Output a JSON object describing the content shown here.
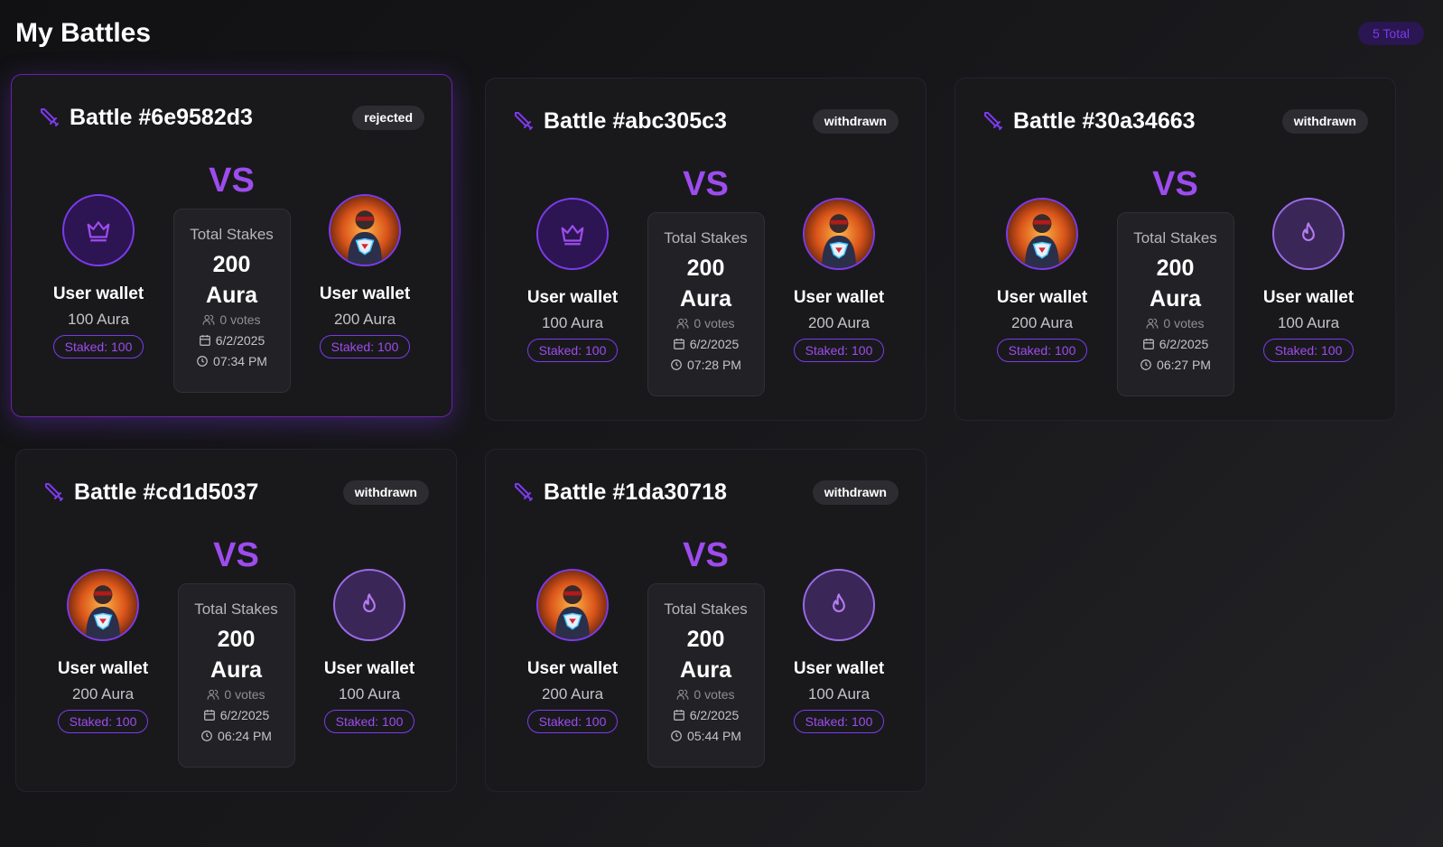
{
  "page": {
    "title": "My Battles",
    "total_badge": "5 Total"
  },
  "colors": {
    "accent": "#9d4ced",
    "card_bg": "#19191c",
    "badge_bg": "#2d2d31"
  },
  "battles": [
    {
      "title": "Battle #6e9582d3",
      "status": "rejected",
      "vs": "VS",
      "left": {
        "avatar": "crown-icon",
        "name": "User wallet",
        "aura": "100 Aura",
        "staked": "Staked: 100"
      },
      "right": {
        "avatar": "hero-avatar",
        "name": "User wallet",
        "aura": "200 Aura",
        "staked": "Staked: 100"
      },
      "stakes_label": "Total Stakes",
      "stakes_amount": "200 Aura",
      "votes": "0 votes",
      "date": "6/2/2025",
      "time": "07:34 PM"
    },
    {
      "title": "Battle #abc305c3",
      "status": "withdrawn",
      "vs": "VS",
      "left": {
        "avatar": "crown-icon",
        "name": "User wallet",
        "aura": "100 Aura",
        "staked": "Staked: 100"
      },
      "right": {
        "avatar": "hero-avatar",
        "name": "User wallet",
        "aura": "200 Aura",
        "staked": "Staked: 100"
      },
      "stakes_label": "Total Stakes",
      "stakes_amount": "200 Aura",
      "votes": "0 votes",
      "date": "6/2/2025",
      "time": "07:28 PM"
    },
    {
      "title": "Battle #30a34663",
      "status": "withdrawn",
      "vs": "VS",
      "left": {
        "avatar": "hero-avatar",
        "name": "User wallet",
        "aura": "200 Aura",
        "staked": "Staked: 100"
      },
      "right": {
        "avatar": "flame-icon",
        "name": "User wallet",
        "aura": "100 Aura",
        "staked": "Staked: 100"
      },
      "stakes_label": "Total Stakes",
      "stakes_amount": "200 Aura",
      "votes": "0 votes",
      "date": "6/2/2025",
      "time": "06:27 PM"
    },
    {
      "title": "Battle #cd1d5037",
      "status": "withdrawn",
      "vs": "VS",
      "left": {
        "avatar": "hero-avatar",
        "name": "User wallet",
        "aura": "200 Aura",
        "staked": "Staked: 100"
      },
      "right": {
        "avatar": "flame-icon",
        "name": "User wallet",
        "aura": "100 Aura",
        "staked": "Staked: 100"
      },
      "stakes_label": "Total Stakes",
      "stakes_amount": "200 Aura",
      "votes": "0 votes",
      "date": "6/2/2025",
      "time": "06:24 PM"
    },
    {
      "title": "Battle #1da30718",
      "status": "withdrawn",
      "vs": "VS",
      "left": {
        "avatar": "hero-avatar",
        "name": "User wallet",
        "aura": "200 Aura",
        "staked": "Staked: 100"
      },
      "right": {
        "avatar": "flame-icon",
        "name": "User wallet",
        "aura": "100 Aura",
        "staked": "Staked: 100"
      },
      "stakes_label": "Total Stakes",
      "stakes_amount": "200 Aura",
      "votes": "0 votes",
      "date": "6/2/2025",
      "time": "05:44 PM"
    }
  ]
}
